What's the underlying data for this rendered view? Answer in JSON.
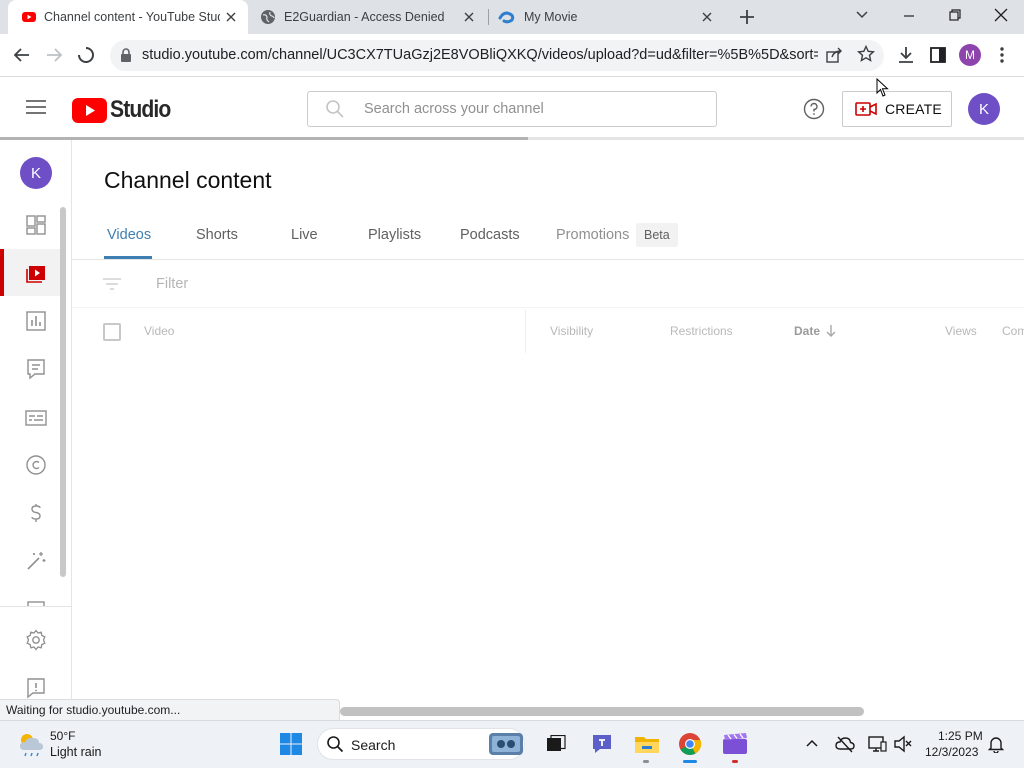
{
  "browser": {
    "tabs": [
      {
        "title": "Channel content - YouTube Studio",
        "active": true
      },
      {
        "title": "E2Guardian - Access Denied",
        "active": false
      },
      {
        "title": "My Movie",
        "active": false
      }
    ],
    "url": "studio.youtube.com/channel/UC3CX7TUaGzj2E8VOBliQXKQ/videos/upload?d=ud&filter=%5B%5D&sort=%...",
    "profile_initial": "M",
    "status_text": "Waiting for studio.youtube.com..."
  },
  "studio": {
    "logo_text": "Studio",
    "search_placeholder": "Search across your channel",
    "create_label": "CREATE",
    "account_initial": "K"
  },
  "nav": {
    "channel_initial": "K",
    "items": [
      "dashboard-icon",
      "content-icon",
      "analytics-icon",
      "comments-icon",
      "subtitles-icon",
      "copyright-icon",
      "earn-icon",
      "customization-icon",
      "audio-library-icon"
    ],
    "active_item": "content-icon",
    "bottom_items": [
      "settings-icon",
      "feedback-icon"
    ]
  },
  "main": {
    "title": "Channel content",
    "tabs": [
      {
        "label": "Videos",
        "active": true
      },
      {
        "label": "Shorts"
      },
      {
        "label": "Live"
      },
      {
        "label": "Playlists"
      },
      {
        "label": "Podcasts"
      },
      {
        "label": "Promotions"
      }
    ],
    "beta_badge": "Beta",
    "filter_placeholder": "Filter",
    "columns": [
      "Video",
      "Visibility",
      "Restrictions",
      "Date",
      "Views",
      "Com"
    ]
  },
  "taskbar": {
    "weather_temp": "50°F",
    "weather_desc": "Light rain",
    "search_label": "Search",
    "time": "1:25 PM",
    "date": "12/3/2023"
  },
  "colors": {
    "youtube_red": "#ff0000",
    "active_tab_blue": "#3e7fb3",
    "avatar_purple": "#6f4fc6"
  }
}
